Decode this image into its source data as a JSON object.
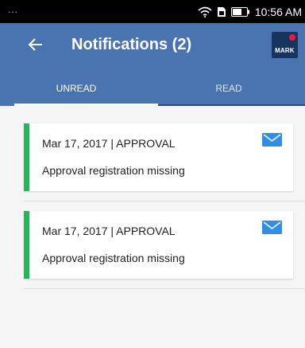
{
  "status_bar": {
    "dots": "...",
    "time": "10:56 AM"
  },
  "app_bar": {
    "title": "Notifications (2)",
    "logo_text": "MARK"
  },
  "tabs": [
    {
      "label": "UNREAD",
      "active": true
    },
    {
      "label": "READ",
      "active": false
    }
  ],
  "notifications": [
    {
      "meta": "Mar 17, 2017 | APPROVAL",
      "text": "Approval registration missing"
    },
    {
      "meta": "Mar 17, 2017 | APPROVAL",
      "text": "Approval registration missing"
    }
  ],
  "colors": {
    "app_bar": "#4a74b0",
    "status_accent": "#28b45b",
    "mail_icon": "#2e8fe6",
    "logo_dot": "#e8194b"
  }
}
